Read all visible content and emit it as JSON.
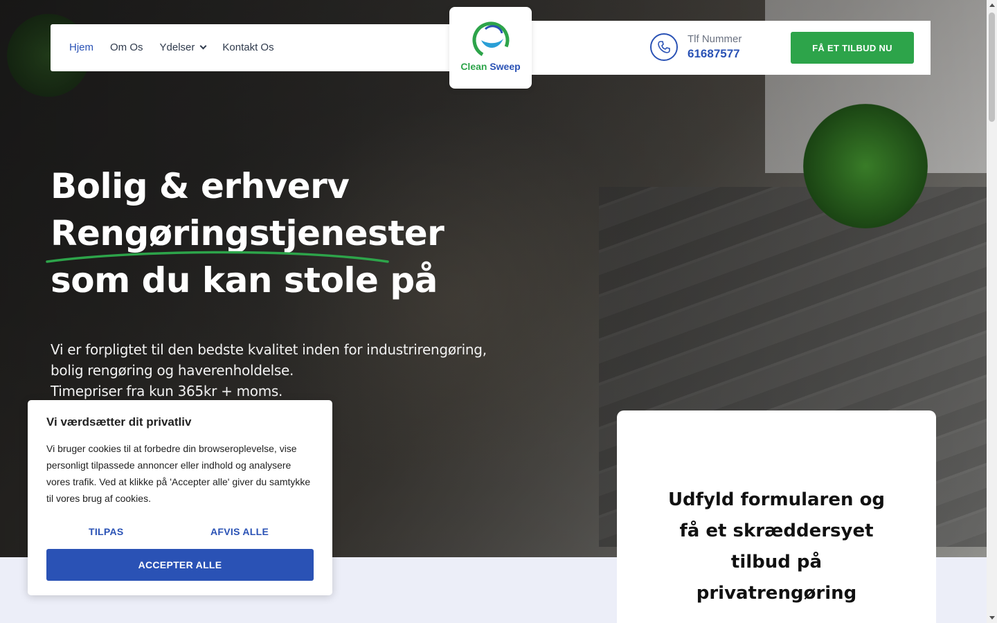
{
  "nav": {
    "items": [
      {
        "label": "Hjem",
        "active": true
      },
      {
        "label": "Om Os",
        "active": false
      },
      {
        "label": "Ydelser",
        "active": false,
        "dropdown": true
      },
      {
        "label": "Kontakt Os",
        "active": false
      }
    ]
  },
  "logo": {
    "word1": "Clean",
    "word2": "Sweep"
  },
  "contact": {
    "label": "Tlf Nummer",
    "number": "61687577",
    "icon": "phone-icon"
  },
  "cta": {
    "label": "FÅ ET TILBUD NU"
  },
  "hero": {
    "line1": "Bolig & erhverv",
    "line2": "Rengøringstjenester",
    "line3": "som du kan stole på",
    "intro": [
      "Vi er forpligtet til den bedste kvalitet inden for industrirengøring,",
      "bolig rengøring og haverenholdelse.",
      "Timepriser fra kun 365kr + moms."
    ]
  },
  "form": {
    "title_lines": [
      "Udfyld formularen og",
      "få et skræddersyet",
      "tilbud på",
      "privatrengøring"
    ]
  },
  "cookie": {
    "title": "Vi værdsætter dit privatliv",
    "body": "Vi bruger cookies til at forbedre din browseroplevelse, vise personligt tilpassede annoncer eller indhold og analysere vores trafik. Ved at klikke på 'Accepter alle' giver du samtykke til vores brug af cookies.",
    "customize": "TILPAS",
    "reject": "AFVIS ALLE",
    "accept": "ACCEPTER ALLE"
  },
  "colors": {
    "brand_blue": "#2a52b5",
    "brand_green": "#2da44a"
  }
}
